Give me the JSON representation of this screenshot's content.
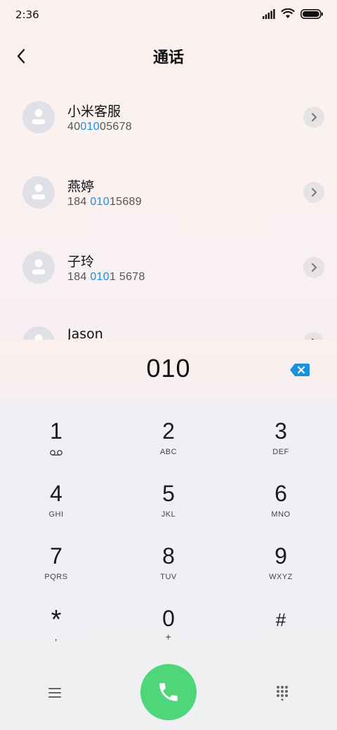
{
  "status_bar": {
    "time": "2:36"
  },
  "header": {
    "title": "通话"
  },
  "contacts": [
    {
      "name": "小米客服",
      "number_pre": "40",
      "number_match": "010",
      "number_post": "05678"
    },
    {
      "name": "燕婷",
      "number_pre": "184 ",
      "number_match": "010",
      "number_post": "15689"
    },
    {
      "name": "子玲",
      "number_pre": "184 ",
      "number_match": "010",
      "number_post": "1 5678"
    },
    {
      "name": "Jason",
      "number_pre": "",
      "number_match": "",
      "number_post": ""
    }
  ],
  "dialer": {
    "entered_number": "010"
  },
  "keypad": [
    {
      "digit": "1",
      "sub": ""
    },
    {
      "digit": "2",
      "sub": "ABC"
    },
    {
      "digit": "3",
      "sub": "DEF"
    },
    {
      "digit": "4",
      "sub": "GHI"
    },
    {
      "digit": "5",
      "sub": "JKL"
    },
    {
      "digit": "6",
      "sub": "MNO"
    },
    {
      "digit": "7",
      "sub": "PQRS"
    },
    {
      "digit": "8",
      "sub": "TUV"
    },
    {
      "digit": "9",
      "sub": "WXYZ"
    },
    {
      "digit": "*",
      "sub": ","
    },
    {
      "digit": "0",
      "sub": "+"
    },
    {
      "digit": "#",
      "sub": ""
    }
  ],
  "icons": {
    "voicemail": "voicemail-icon",
    "call": "phone-icon",
    "delete": "backspace-icon",
    "menu": "menu-icon",
    "dialpad": "dialpad-icon"
  },
  "colors": {
    "highlight": "#1b8fe0",
    "call_button": "#4fd67a"
  }
}
